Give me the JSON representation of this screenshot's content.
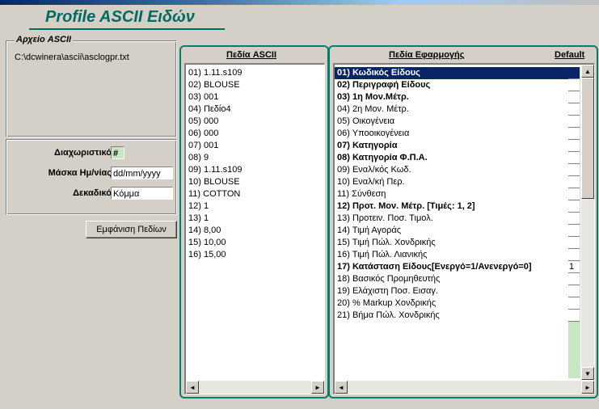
{
  "window": {
    "title": "Profile ASCII Ειδών"
  },
  "file_group": {
    "legend": "Αρχείο ASCII",
    "path": "C:\\dcwinera\\ascii\\asclogpr.txt"
  },
  "settings": {
    "delimiter_label": "Διαχωριστικό",
    "delimiter_value": "#",
    "date_mask_label": "Μάσκα Ημ/νίας",
    "date_mask_value": "dd/mm/yyyy",
    "decimal_label": "Δεκαδικό",
    "decimal_value": "Κόμμα"
  },
  "show_fields_button": "Εμφάνιση Πεδίων",
  "ascii_fields": {
    "header": "Πεδία ASCII",
    "items": [
      "01) 1.11.s109",
      "02) BLOUSE",
      "03) 001",
      "04) Πεδίο4",
      "05) 000",
      "06) 000",
      "07) 001",
      "08) 9",
      "09) 1.11.s109",
      "10) BLOUSE",
      "11) COTTON",
      "12) 1",
      "13) 1",
      "14) 8,00",
      "15) 10,00",
      "16) 15,00"
    ]
  },
  "app_fields": {
    "header": "Πεδία Εφαρμογής",
    "default_header": "Default",
    "items": [
      {
        "label": "01) Κωδικός Είδους",
        "bold": true,
        "selected": true,
        "default": ""
      },
      {
        "label": "02) Περιγραφή Είδους",
        "bold": true,
        "selected": false,
        "default": ""
      },
      {
        "label": "03) 1η Μον.Μέτρ.",
        "bold": true,
        "selected": false,
        "default": ""
      },
      {
        "label": "04) 2η Μον. Μέτρ.",
        "bold": false,
        "selected": false,
        "default": ""
      },
      {
        "label": "05) Οικογένεια",
        "bold": false,
        "selected": false,
        "default": ""
      },
      {
        "label": "06) Υποοικογένεια",
        "bold": false,
        "selected": false,
        "default": ""
      },
      {
        "label": "07) Κατηγορία",
        "bold": true,
        "selected": false,
        "default": ""
      },
      {
        "label": "08) Κατηγορία Φ.Π.Α.",
        "bold": true,
        "selected": false,
        "default": ""
      },
      {
        "label": "09) Εναλ/κός Κωδ.",
        "bold": false,
        "selected": false,
        "default": ""
      },
      {
        "label": "10) Εναλ/κή Περ.",
        "bold": false,
        "selected": false,
        "default": ""
      },
      {
        "label": "11) Σύνθεση",
        "bold": false,
        "selected": false,
        "default": ""
      },
      {
        "label": "12) Προτ. Μον. Μέτρ. [Τιμές: 1, 2]",
        "bold": true,
        "selected": false,
        "default": ""
      },
      {
        "label": "13) Προτειν. Ποσ. Τιμολ.",
        "bold": false,
        "selected": false,
        "default": ""
      },
      {
        "label": "14) Τιμή Αγοράς",
        "bold": false,
        "selected": false,
        "default": ""
      },
      {
        "label": "15) Τιμή Πώλ. Χονδρικής",
        "bold": false,
        "selected": false,
        "default": ""
      },
      {
        "label": "16) Τιμή Πώλ. Λιανικής",
        "bold": false,
        "selected": false,
        "default": ""
      },
      {
        "label": "17) Κατάσταση Είδους[Ενεργό=1/Ανενεργό=0]",
        "bold": true,
        "selected": false,
        "default": "1"
      },
      {
        "label": "18) Βασικός Προμηθευτής",
        "bold": false,
        "selected": false,
        "default": ""
      },
      {
        "label": "19) Ελάχιστη Ποσ. Εισαγ.",
        "bold": false,
        "selected": false,
        "default": ""
      },
      {
        "label": "20) % Markup Χονδρικής",
        "bold": false,
        "selected": false,
        "default": ""
      },
      {
        "label": "21) Βήμα Πώλ. Χονδρικής",
        "bold": false,
        "selected": false,
        "default": ""
      }
    ]
  },
  "icons": {
    "scroll_left": "◄",
    "scroll_right": "►",
    "scroll_up": "▲",
    "scroll_down": "▼"
  }
}
